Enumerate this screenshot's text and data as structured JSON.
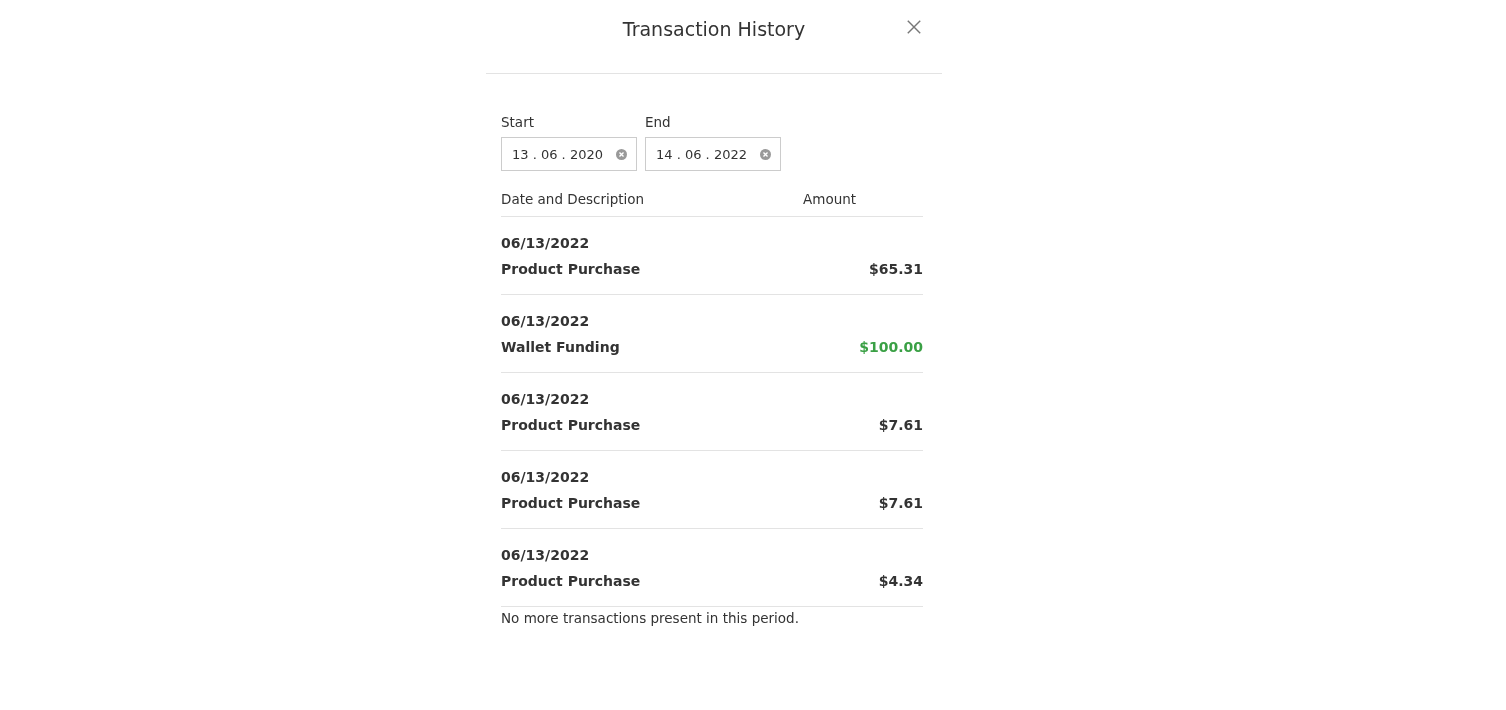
{
  "dialog": {
    "title": "Transaction History"
  },
  "date_range": {
    "start": {
      "label": "Start",
      "value": "13 . 06 . 2020"
    },
    "end": {
      "label": "End",
      "value": "14 . 06 . 2022"
    }
  },
  "table": {
    "columns": [
      "Date and Description",
      "Amount"
    ],
    "rows": [
      {
        "date": "06/13/2022",
        "description": "Product Purchase",
        "amount": "$65.31",
        "kind": "debit"
      },
      {
        "date": "06/13/2022",
        "description": "Wallet Funding",
        "amount": "$100.00",
        "kind": "credit"
      },
      {
        "date": "06/13/2022",
        "description": "Product Purchase",
        "amount": "$7.61",
        "kind": "debit"
      },
      {
        "date": "06/13/2022",
        "description": "Product Purchase",
        "amount": "$7.61",
        "kind": "debit"
      },
      {
        "date": "06/13/2022",
        "description": "Product Purchase",
        "amount": "$4.34",
        "kind": "debit"
      }
    ]
  },
  "footer_note": "No more transactions present in this period."
}
